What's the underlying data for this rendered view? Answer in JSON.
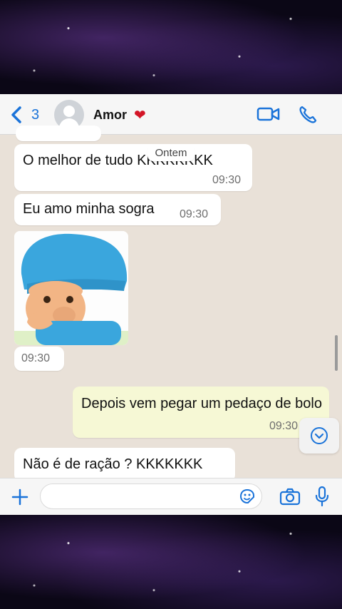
{
  "header": {
    "back_count": "3",
    "contact_name": "Amor",
    "heart": "❤"
  },
  "date_separator": "Ontem",
  "messages": [
    {
      "text": "O melhor de tudo KKKKKKKK",
      "time": "09:30"
    },
    {
      "text": "Eu amo minha sogra",
      "time": "09:30"
    },
    {
      "time": "09:30"
    },
    {
      "text": "Depois vem pegar um pedaço de bolo",
      "time": "09:30"
    },
    {
      "text": "Não é de ração ? KKKKKKK"
    }
  ],
  "colors": {
    "accent": "#1a73d9",
    "incoming_bubble": "#ffffff",
    "outgoing_bubble": "#f6f8d5",
    "chat_background": "#e9e1d8",
    "heart": "#d31527"
  },
  "icons": [
    "chevron-left-icon",
    "avatar-icon",
    "heart-icon",
    "video-call-icon",
    "phone-call-icon",
    "chevron-down-icon",
    "plus-icon",
    "sticker-icon",
    "camera-icon",
    "microphone-icon"
  ],
  "input": {
    "placeholder": ""
  }
}
